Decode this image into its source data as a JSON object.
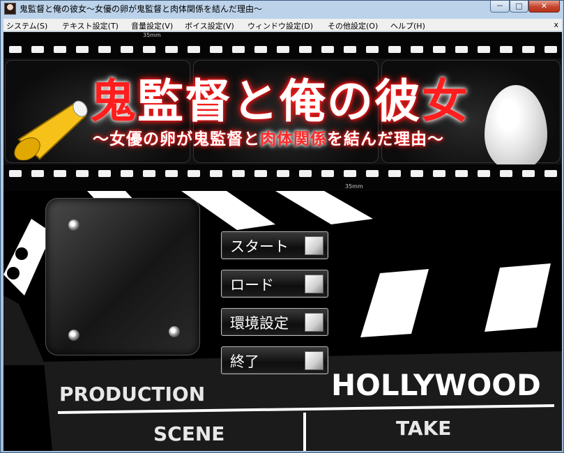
{
  "window": {
    "title": "鬼監督と俺の彼女～女優の卵が鬼監督と肉体関係を結んだ理由～",
    "controls": {
      "minimize": "－",
      "maximize": "□",
      "close": "✕"
    }
  },
  "menubar": {
    "items": [
      {
        "label": "システム(S)"
      },
      {
        "label": "テキスト設定(T)"
      },
      {
        "label": "音量設定(V)"
      },
      {
        "label": "ボイス設定(V)"
      },
      {
        "label": "ウィンドウ設定(D)"
      },
      {
        "label": "その他設定(O)"
      },
      {
        "label": "ヘルプ(H)"
      }
    ],
    "close": "x"
  },
  "banner": {
    "film_mark_top": "35mm",
    "film_mark_bottom": "35mm",
    "title_part1": "鬼",
    "title_part2": "監督と俺の彼",
    "title_part3": "女",
    "subtitle_part1": "～女優の卵が鬼監督と",
    "subtitle_part2": "肉体関係",
    "subtitle_part3": "を結んだ理由～"
  },
  "menu": {
    "start": "スタート",
    "load": "ロード",
    "config": "環境設定",
    "exit": "終了"
  },
  "clapperboard": {
    "production": "PRODUCTION",
    "brand": "HOLLYWOOD",
    "scene": "SCENE",
    "take": "TAKE"
  },
  "colors": {
    "title_red": "#ff1d1d",
    "title_bar": "#bcd3ea",
    "close_button": "#c6452f"
  },
  "icons": {
    "app": "character-portrait-icon",
    "megaphone": "megaphone-icon",
    "egg": "egg-icon"
  }
}
